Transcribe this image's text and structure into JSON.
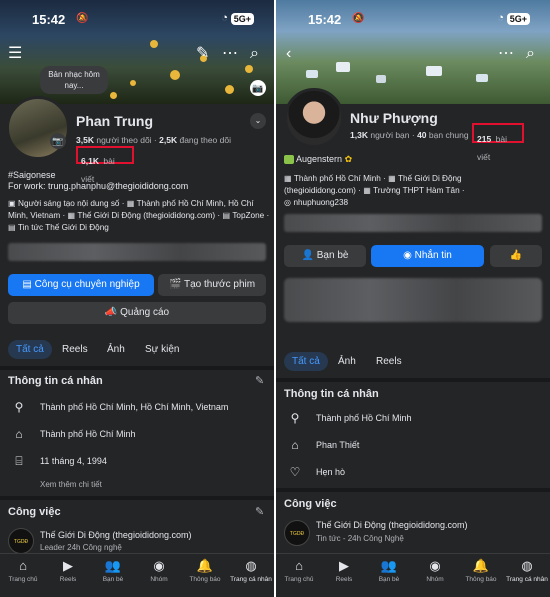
{
  "left": {
    "status": {
      "time": "15:42",
      "network": "5G+"
    },
    "music_bubble": "Bản nhạc hôm nay...",
    "name": "Phan Trung",
    "followers_count": "3,5K",
    "followers_label": "người theo dõi",
    "following_count": "2,5K",
    "following_label": "đang theo dõi",
    "posts_count": "6,1K",
    "posts_label": "bài viết",
    "bio_line1": "#Saigonese",
    "bio_line2": "For work: trung.phanphu@thegioididong.com",
    "details": [
      "Người sáng tạo nội dung số",
      "Thành phố Hồ Chí Minh, Hồ Chí Minh, Vietnam",
      "Thế Giới Di Động (thegioididong.com)",
      "TopZone",
      "Tin tức Thế Giới Di Động"
    ],
    "btn_pro": "Công cụ chuyên nghiệp",
    "btn_reel": "Tạo thước phim",
    "btn_ads": "Quảng cáo",
    "tabs": [
      "Tất cả",
      "Reels",
      "Ảnh",
      "Sự kiện"
    ],
    "section_info": "Thông tin cá nhân",
    "info_rows": [
      "Thành phố Hồ Chí Minh, Hồ Chí Minh, Vietnam",
      "Thành phố Hồ Chí Minh",
      "11 tháng 4, 1994"
    ],
    "see_more": "Xem thêm chi tiết",
    "section_work": "Công việc",
    "work_title": "Thế Giới Di Động (thegioididong.com)",
    "work_sub": "Leader 24h Công nghệ"
  },
  "right": {
    "status": {
      "time": "15:42",
      "network": "5G+"
    },
    "name": "Như Phượng",
    "friends_count": "1,3K",
    "friends_label": "người bạn",
    "mutual_count": "40",
    "mutual_label": "bạn chung",
    "posts_count": "215",
    "posts_label": "bài viết",
    "bio": "Augenstern",
    "details_l1a": "Thành phố Hồ Chí Minh",
    "details_l1b": "Thế Giới Di Động",
    "details_l2a": "(thegioididong.com)",
    "details_l2b": "Trường THPT Hàm Tân",
    "details_l3": "nhuphuong238",
    "btn_friends": "Bạn bè",
    "btn_message": "Nhắn tin",
    "tabs": [
      "Tất cả",
      "Ảnh",
      "Reels"
    ],
    "section_info": "Thông tin cá nhân",
    "info_rows": [
      "Thành phố Hồ Chí Minh",
      "Phan Thiết",
      "Hẹn hò"
    ],
    "section_work": "Công việc",
    "work_title": "Thế Giới Di Động (thegioididong.com)",
    "work_sub": "Tin tức - 24h Công Nghệ"
  },
  "nav": [
    "Trang chủ",
    "Reels",
    "Bạn bè",
    "Nhóm",
    "Thông báo",
    "Trang cá nhân"
  ],
  "accent": "#1877f2",
  "highlight": "#e0102e"
}
